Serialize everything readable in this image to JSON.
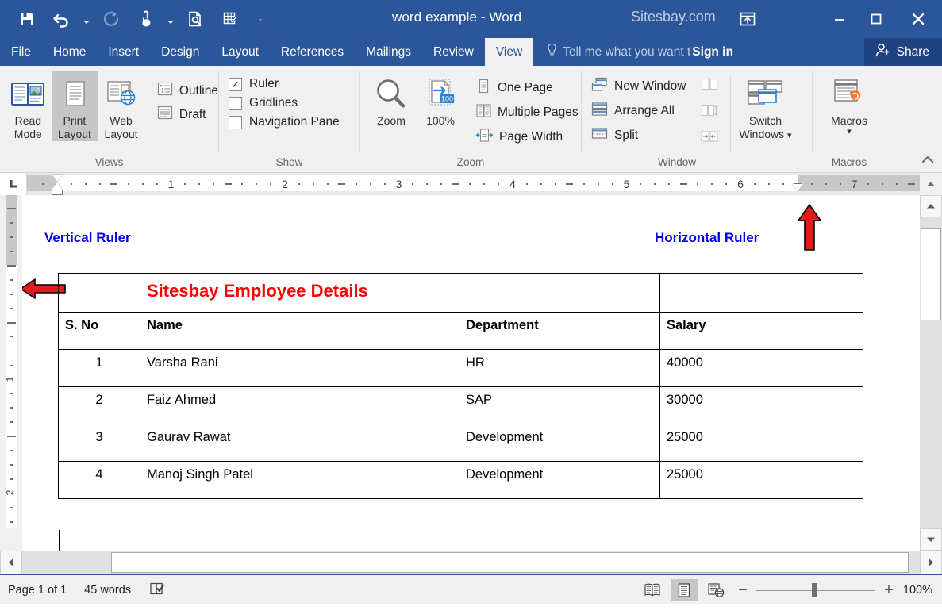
{
  "app": {
    "document_title": "word example - Word",
    "watermark": "Sitesbay.com"
  },
  "quick_access": {
    "items": [
      {
        "name": "save-icon",
        "label": "Save"
      },
      {
        "name": "undo-icon",
        "label": "Undo"
      },
      {
        "name": "redo-icon",
        "label": "Repeat"
      },
      {
        "name": "touch-mode-icon",
        "label": "Touch/Mouse Mode"
      },
      {
        "name": "print-preview-icon",
        "label": "Print Preview and Print"
      },
      {
        "name": "draw-table-icon",
        "label": "Draw Table"
      },
      {
        "name": "customize-qat-icon",
        "label": "Customize Quick Access Toolbar"
      }
    ]
  },
  "window_controls": {
    "ribbon_display": "Ribbon Display Options",
    "minimize": "Minimize",
    "restore": "Restore Down",
    "close": "Close"
  },
  "tabs": [
    {
      "label": "File",
      "active": false
    },
    {
      "label": "Home",
      "active": false
    },
    {
      "label": "Insert",
      "active": false
    },
    {
      "label": "Design",
      "active": false
    },
    {
      "label": "Layout",
      "active": false
    },
    {
      "label": "References",
      "active": false
    },
    {
      "label": "Mailings",
      "active": false
    },
    {
      "label": "Review",
      "active": false
    },
    {
      "label": "View",
      "active": true
    }
  ],
  "tell_me": "Tell me what you want t",
  "sign_in": "Sign in",
  "share": "Share",
  "ribbon": {
    "groups": {
      "views": {
        "label": "Views",
        "buttons": [
          {
            "label_line1": "Read",
            "label_line2": "Mode",
            "selected": false
          },
          {
            "label_line1": "Print",
            "label_line2": "Layout",
            "selected": true
          },
          {
            "label_line1": "Web",
            "label_line2": "Layout",
            "selected": false
          }
        ],
        "small_items": [
          {
            "label": "Outline"
          },
          {
            "label": "Draft"
          }
        ]
      },
      "show": {
        "label": "Show",
        "checkboxes": [
          {
            "label": "Ruler",
            "checked": true
          },
          {
            "label": "Gridlines",
            "checked": false
          },
          {
            "label": "Navigation Pane",
            "checked": false
          }
        ]
      },
      "zoom": {
        "label": "Zoom",
        "buttons": [
          {
            "label": "Zoom"
          },
          {
            "label": "100%"
          }
        ],
        "small_items": [
          {
            "label": "One Page"
          },
          {
            "label": "Multiple Pages"
          },
          {
            "label": "Page Width"
          }
        ]
      },
      "window": {
        "label": "Window",
        "small_items": [
          {
            "label": "New Window"
          },
          {
            "label": "Arrange All"
          },
          {
            "label": "Split"
          }
        ],
        "icon_only_items": [
          {
            "name": "view-side-by-side-icon",
            "disabled": true
          },
          {
            "name": "synchronous-scrolling-icon",
            "disabled": true
          },
          {
            "name": "reset-window-position-icon",
            "disabled": true
          }
        ],
        "switch_windows": {
          "label_line1": "Switch",
          "label_line2": "Windows"
        }
      },
      "macros": {
        "label": "Macros",
        "button": {
          "label": "Macros"
        }
      }
    }
  },
  "rulers": {
    "horizontal": {
      "numbers": [
        "1",
        "2",
        "3",
        "4",
        "5",
        "6",
        "7"
      ],
      "unit": "inch"
    },
    "vertical": {
      "numbers": [
        "1",
        "2"
      ],
      "unit": "inch"
    }
  },
  "annotations": [
    {
      "label": "Vertical Ruler",
      "color": "#0000f0"
    },
    {
      "label": "Horizontal Ruler",
      "color": "#0000f0"
    }
  ],
  "arrows": {
    "color": "#e01b1b",
    "items": [
      {
        "name": "arrow-pointing-to-ruler-checkbox",
        "direction": "left"
      },
      {
        "name": "arrow-pointing-to-horizontal-ruler",
        "direction": "up"
      },
      {
        "name": "arrow-pointing-to-vertical-ruler",
        "direction": "left"
      }
    ]
  },
  "document": {
    "table": {
      "title": "Sitesbay Employee Details",
      "title_color": "#ff0000",
      "headers": [
        "S. No",
        "Name",
        "Department",
        "Salary"
      ],
      "rows": [
        {
          "sno": "1",
          "name": "Varsha Rani",
          "department": "HR",
          "salary": "40000"
        },
        {
          "sno": "2",
          "name": "Faiz Ahmed",
          "department": "SAP",
          "salary": "30000"
        },
        {
          "sno": "3",
          "name": "Gaurav Rawat",
          "department": "Development",
          "salary": "25000"
        },
        {
          "sno": "4",
          "name": "Manoj Singh Patel",
          "department": "Development",
          "salary": "25000"
        }
      ]
    }
  },
  "status_bar": {
    "page": "Page 1 of 1",
    "words": "45 words",
    "proofing_icon": "proofing-errors-icon",
    "views": [
      {
        "name": "read-mode-view-button",
        "selected": false
      },
      {
        "name": "print-layout-view-button",
        "selected": true
      },
      {
        "name": "web-layout-view-button",
        "selected": false
      }
    ],
    "zoom_out": "−",
    "zoom_in": "+",
    "zoom_level": "100%"
  }
}
